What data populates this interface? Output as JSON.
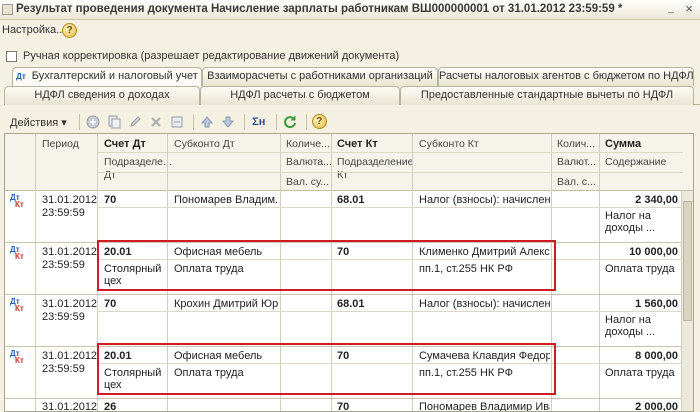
{
  "window": {
    "title": "Результат проведения документа Начисление зарплаты работникам ВШ000000001 от 31.01.2012 23:59:59 *",
    "min": "_",
    "close": "×"
  },
  "menu": {
    "settings": "Настройка...",
    "help": "?"
  },
  "manual_edit_label": "Ручная корректировка (разрешает редактирование движений документа)",
  "tabs_row1": [
    "Бухгалтерский и налоговый учет",
    "Взаиморасчеты с работниками организаций",
    "Расчеты налоговых агентов с бюджетом по НДФЛ"
  ],
  "tabs_row2": [
    "НДФЛ сведения о доходах",
    "НДФЛ расчеты с бюджетом",
    "Предоставленные стандартные вычеты по НДФЛ"
  ],
  "toolbar": {
    "actions": "Действия",
    "sum_icon": "Σн",
    "help": "?"
  },
  "columns": {
    "period": "Период",
    "schet_dt": "Счет Дт",
    "subkonto_dt": "Субконто Дт",
    "kol_dt": "Количе...",
    "schet_kt": "Счет Кт",
    "subkonto_kt": "Субконто Кт",
    "kol_kt": "Колич...",
    "summa": "Сумма",
    "podr_dt": "Подразделе... Дт",
    "podr_dt_1": "Подразделе...",
    "podr_dt_2": "Дт",
    "val_dt": "Валюта...",
    "valsum_dt": "Вал. су...",
    "podr_kt_1": "Подразделение",
    "podr_kt_2": "Кт",
    "val_kt": "Валют...",
    "valsum_kt": "Вал. с...",
    "content": "Содержание"
  },
  "rows": [
    {
      "period": "31.01.2012",
      "time": "23:59:59",
      "schet_dt": "70",
      "podr_dt": "",
      "sub_dt_1": "Пономарев Владим...",
      "sub_dt_2": "",
      "schet_kt": "68.01",
      "sub_kt_1": "Налог (взносы): начислен...",
      "sub_kt_2": "",
      "summa": "2 340,00",
      "content_1": "Налог на",
      "content_2": "доходы ..."
    },
    {
      "period": "31.01.2012",
      "time": "23:59:59",
      "schet_dt": "20.01",
      "podr_dt": "Столярный",
      "podr_dt_2": "цех",
      "sub_dt_1": "Офисная мебель",
      "sub_dt_2": "Оплата труда",
      "schet_kt": "70",
      "sub_kt_1": "Клименко Дмитрий Алекс...",
      "sub_kt_2": "пп.1, ст.255 НК РФ",
      "summa": "10 000,00",
      "content_1": "Оплата труда",
      "content_2": ""
    },
    {
      "period": "31.01.2012",
      "time": "23:59:59",
      "schet_dt": "70",
      "podr_dt": "",
      "sub_dt_1": "Крохин Дмитрий Юр...",
      "sub_dt_2": "",
      "schet_kt": "68.01",
      "sub_kt_1": "Налог (взносы): начислен...",
      "sub_kt_2": "",
      "summa": "1 560,00",
      "content_1": "Налог на",
      "content_2": "доходы ..."
    },
    {
      "period": "31.01.2012",
      "time": "23:59:59",
      "schet_dt": "20.01",
      "podr_dt": "Столярный",
      "podr_dt_2": "цех",
      "sub_dt_1": "Офисная мебель",
      "sub_dt_2": "Оплата труда",
      "schet_kt": "70",
      "sub_kt_1": "Сумачева Клавдия Федор...",
      "sub_kt_2": "пп.1, ст.255 НК РФ",
      "summa": "8 000,00",
      "content_1": "Оплата труда",
      "content_2": ""
    },
    {
      "period": "31.01.2012",
      "time": "",
      "schet_dt": "26",
      "sub_dt_1": "",
      "schet_kt": "70",
      "sub_kt_1": "Пономарев Владимир Ива...",
      "summa": "2 000,00"
    }
  ],
  "row_icon": {
    "dt": "Дт",
    "kt": "Кт"
  },
  "colors": {
    "highlight": "#d11b24",
    "background": "#f4f1e3"
  }
}
